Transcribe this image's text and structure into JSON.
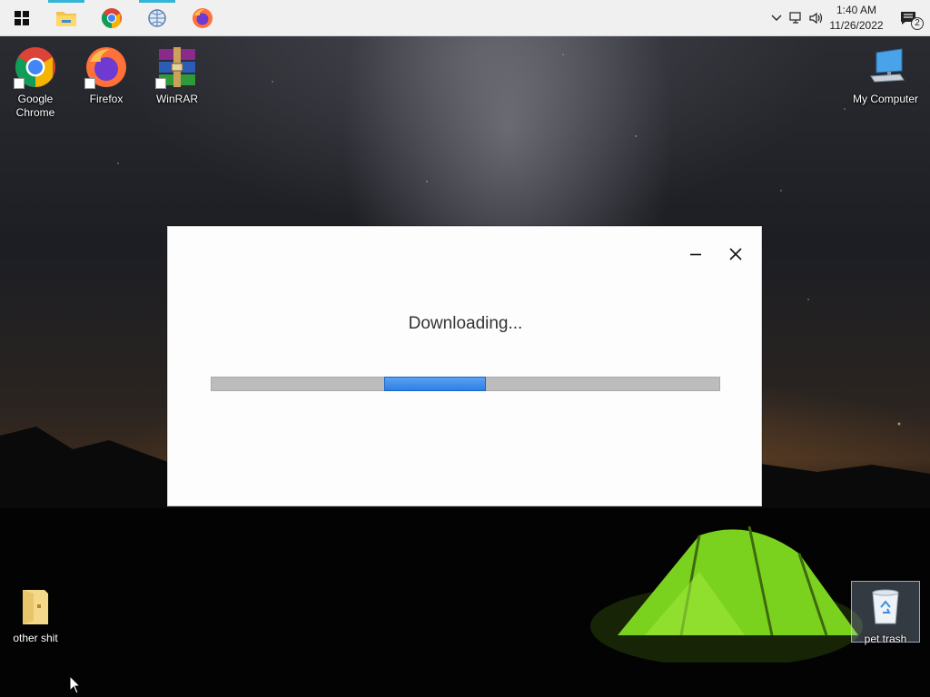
{
  "taskbar": {
    "start_label": "Start",
    "pinned": [
      {
        "name": "File Explorer",
        "icon": "folder-icon",
        "running": true
      },
      {
        "name": "Google Chrome",
        "icon": "chrome-icon",
        "running": false
      },
      {
        "name": "Network app",
        "icon": "network-globe-icon",
        "running": true
      },
      {
        "name": "Firefox",
        "icon": "firefox-icon",
        "running": false
      }
    ],
    "tray": {
      "time": "1:40 AM",
      "date": "11/26/2022",
      "notification_count": "2"
    }
  },
  "desktop": {
    "icons": [
      {
        "label": "Google Chrome",
        "icon": "chrome-icon"
      },
      {
        "label": "Firefox",
        "icon": "firefox-icon"
      },
      {
        "label": "WinRAR",
        "icon": "winrar-icon"
      },
      {
        "label": "My Computer",
        "icon": "computer-icon"
      },
      {
        "label": "other shit",
        "icon": "folder-icon"
      },
      {
        "label": "pet trash",
        "icon": "recycle-bin-icon"
      }
    ]
  },
  "dialog": {
    "title": "Downloading...",
    "progress_mode": "indeterminate",
    "accent": "#2e7ee6"
  }
}
